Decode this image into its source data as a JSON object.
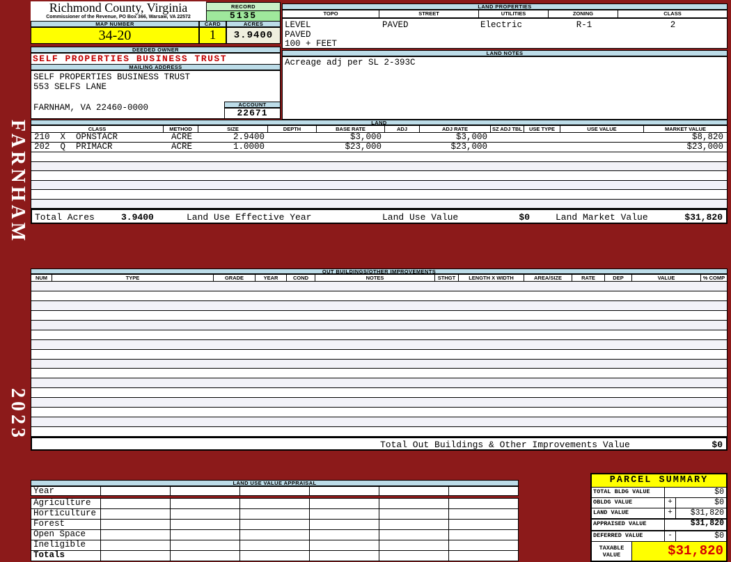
{
  "sidebar": {
    "district": "FARNHAM",
    "year": "2023"
  },
  "county": {
    "title": "Richmond County, Virginia",
    "subtitle": "Commissioner of the Revenue, PO Box 366, Warsaw, VA 22572"
  },
  "record": {
    "label": "RECORD",
    "value": "5135"
  },
  "map_number": {
    "label": "MAP NUMBER",
    "value": "34-20"
  },
  "card": {
    "label": "CARD",
    "value": "1"
  },
  "acres": {
    "label": "ACRES",
    "value": "3.9400"
  },
  "deeded_owner": {
    "label": "DEEDED OWNER",
    "value": "SELF PROPERTIES BUSINESS TRUST"
  },
  "mailing_address": {
    "label": "MAILING ADDRESS",
    "line1": "SELF PROPERTIES BUSINESS TRUST",
    "line2": "553 SELFS LANE",
    "line3": "",
    "line4": "FARNHAM, VA 22460-0000"
  },
  "account": {
    "label": "ACCOUNT",
    "value": "22671"
  },
  "land_properties": {
    "title": "LAND PROPERTIES",
    "columns": [
      "TOPO",
      "STREET",
      "UTILITIES",
      "ZONING",
      "CLASS"
    ],
    "topo": "LEVEL",
    "street": "PAVED",
    "utilities": "Electric",
    "zoning": "R-1",
    "class": "2",
    "topo_line2": "PAVED",
    "topo_line3": "100 + FEET"
  },
  "land_notes": {
    "title": "LAND NOTES",
    "text": "Acreage adj per SL 2-393C"
  },
  "land": {
    "title": "LAND",
    "columns": [
      "CLASS",
      "METHOD",
      "SIZE",
      "DEPTH",
      "BASE RATE",
      "ADJ",
      "ADJ RATE",
      "SZ ADJ TBL",
      "USE TYPE",
      "USE VALUE",
      "MARKET VALUE"
    ],
    "rows": [
      {
        "class": "210  X  OPNSTACR",
        "method": "ACRE",
        "size": "2.9400",
        "depth": "",
        "base_rate": "$3,000",
        "adj": "",
        "adj_rate": "$3,000",
        "sz_adj_tbl": "",
        "use_type": "",
        "use_value": "",
        "market_value": "$8,820"
      },
      {
        "class": "202  Q  PRIMACR",
        "method": "ACRE",
        "size": "1.0000",
        "depth": "",
        "base_rate": "$23,000",
        "adj": "",
        "adj_rate": "$23,000",
        "sz_adj_tbl": "",
        "use_type": "",
        "use_value": "",
        "market_value": "$23,000"
      }
    ],
    "totals": {
      "total_acres_label": "Total Acres",
      "total_acres": "3.9400",
      "effective_year_label": "Land Use Effective Year",
      "use_value_label": "Land Use Value",
      "use_value": "$0",
      "market_value_label": "Land Market Value",
      "market_value": "$31,820"
    }
  },
  "out_buildings": {
    "title": "OUT BUILDINGS/OTHER IMPROVEMENTS",
    "columns": [
      "NUM",
      "TYPE",
      "GRADE",
      "YEAR",
      "COND",
      "NOTES",
      "STHGT",
      "LENGTH X WIDTH",
      "AREA/SIZE",
      "RATE",
      "DEP",
      "VALUE",
      "% COMP"
    ],
    "total_label": "Total Out Buildings & Other Improvements Value",
    "total_value": "$0"
  },
  "land_use_appraisal": {
    "title": "LAND USE VALUE APPRAISAL",
    "row_labels": [
      "Year",
      "Agriculture",
      "Horticulture",
      "Forest",
      "Open Space",
      "Ineligible",
      "Totals"
    ]
  },
  "parcel_summary": {
    "title": "PARCEL SUMMARY",
    "rows": [
      {
        "label": "TOTAL BLDG VALUE",
        "op": "",
        "value": "$0"
      },
      {
        "label": "OBLDG VALUE",
        "op": "+",
        "value": "$0"
      },
      {
        "label": "LAND VALUE",
        "op": "+",
        "value": "$31,820"
      },
      {
        "label": "APPRAISED VALUE",
        "op": "",
        "value": "$31,820"
      },
      {
        "label": "DEFERRED VALUE",
        "op": "-",
        "value": "$0"
      }
    ],
    "taxable": {
      "label_line1": "TAXABLE",
      "label_line2": "VALUE",
      "value": "$31,820"
    },
    "colors": {
      "highlight": "#FFFF00",
      "taxable_red": "#D40000"
    }
  }
}
